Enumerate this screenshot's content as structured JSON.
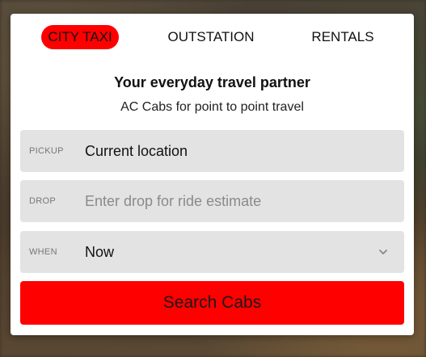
{
  "tabs": [
    {
      "label": "CITY TAXI",
      "active": true
    },
    {
      "label": "OUTSTATION",
      "active": false
    },
    {
      "label": "RENTALS",
      "active": false
    }
  ],
  "headline": "Your everyday travel partner",
  "subline": "AC Cabs for point to point travel",
  "pickup": {
    "label": "PICKUP",
    "value": "Current location"
  },
  "drop": {
    "label": "DROP",
    "placeholder": "Enter drop for ride estimate",
    "value": ""
  },
  "when": {
    "label": "WHEN",
    "value": "Now",
    "icon": "chevron-down-icon"
  },
  "search_button": {
    "label": "Search Cabs"
  },
  "colors": {
    "accent": "#ff0000",
    "field_bg": "#e3e3e3",
    "card_bg": "#ffffff"
  }
}
